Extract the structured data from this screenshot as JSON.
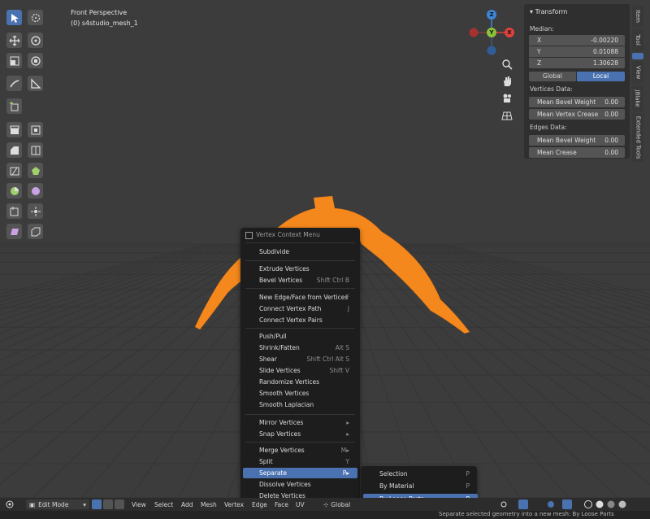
{
  "viewport": {
    "view_name": "Front Perspective",
    "object_name": "(0) s4studio_mesh_1"
  },
  "gizmo": {
    "z": "Z",
    "y": "Y",
    "x": "X"
  },
  "toolbar": {
    "icons": [
      "select-box",
      "cursor",
      "move",
      "rotate",
      "scale",
      "transform",
      "annotate",
      "measure",
      "add-cube",
      "extrude-region",
      "inset-faces",
      "bevel",
      "loop-cut",
      "knife",
      "poly-build",
      "spin",
      "smooth",
      "edge-slide",
      "shrink-fatten",
      "shear",
      "rip-region"
    ]
  },
  "npanel": {
    "title": "Transform",
    "median_label": "Median:",
    "x": {
      "label": "X",
      "value": "-0.00220"
    },
    "y": {
      "label": "Y",
      "value": "0.01088"
    },
    "z": {
      "label": "Z",
      "value": "1.30628"
    },
    "global_label": "Global",
    "local_label": "Local",
    "vertices_data_label": "Vertices Data:",
    "mean_bevel_weight_label": "Mean Bevel Weight",
    "mean_bevel_weight_value": "0.00",
    "mean_vertex_crease_label": "Mean Vertex Crease",
    "mean_vertex_crease_value": "0.00",
    "edges_data_label": "Edges Data:",
    "edge_bevel_weight_label": "Mean Bevel Weight",
    "edge_bevel_weight_value": "0.00",
    "mean_crease_label": "Mean Crease",
    "mean_crease_value": "0.00"
  },
  "sidetabs": [
    "Item",
    "Tool",
    "View",
    "JBlake",
    "Extended Tools"
  ],
  "context_menu": {
    "title": "Vertex Context Menu",
    "items": [
      {
        "label": "Subdivide",
        "shortcut": ""
      },
      {
        "label": "Extrude Vertices",
        "shortcut": ""
      },
      {
        "label": "Bevel Vertices",
        "shortcut": "Shift Ctrl B"
      },
      {
        "label": "New Edge/Face from Vertices",
        "shortcut": "F"
      },
      {
        "label": "Connect Vertex Path",
        "shortcut": "J"
      },
      {
        "label": "Connect Vertex Pairs",
        "shortcut": ""
      },
      {
        "label": "Push/Pull",
        "shortcut": ""
      },
      {
        "label": "Shrink/Fatten",
        "shortcut": "Alt S"
      },
      {
        "label": "Shear",
        "shortcut": "Shift Ctrl Alt S"
      },
      {
        "label": "Slide Vertices",
        "shortcut": "Shift V"
      },
      {
        "label": "Randomize Vertices",
        "shortcut": ""
      },
      {
        "label": "Smooth Vertices",
        "shortcut": ""
      },
      {
        "label": "Smooth Laplacian",
        "shortcut": ""
      },
      {
        "label": "Mirror Vertices",
        "shortcut": "▸"
      },
      {
        "label": "Snap Vertices",
        "shortcut": "▸"
      },
      {
        "label": "Merge Vertices",
        "shortcut": "M▸"
      },
      {
        "label": "Split",
        "shortcut": "Y"
      },
      {
        "label": "Separate",
        "shortcut": "P▸"
      },
      {
        "label": "Dissolve Vertices",
        "shortcut": ""
      },
      {
        "label": "Delete Vertices",
        "shortcut": ""
      }
    ]
  },
  "submenu": {
    "items": [
      {
        "label": "Selection",
        "shortcut": "P"
      },
      {
        "label": "By Material",
        "shortcut": "P"
      },
      {
        "label": "By Loose Parts",
        "shortcut": "P"
      }
    ]
  },
  "header": {
    "mode": "Edit Mode",
    "menus": [
      "View",
      "Select",
      "Add",
      "Mesh",
      "Vertex",
      "Edge",
      "Face",
      "UV"
    ],
    "orientation": "Global"
  },
  "status": {
    "tooltip": "Separate selected geometry into a new mesh: By Loose Parts"
  },
  "colors": {
    "accent": "#4a72b0",
    "mesh": "#ff8c1a",
    "menu_bg": "#1d1d1d",
    "gizmo_x": "#e0413e",
    "gizmo_y": "#8ac23a",
    "gizmo_z": "#3d86d6"
  }
}
